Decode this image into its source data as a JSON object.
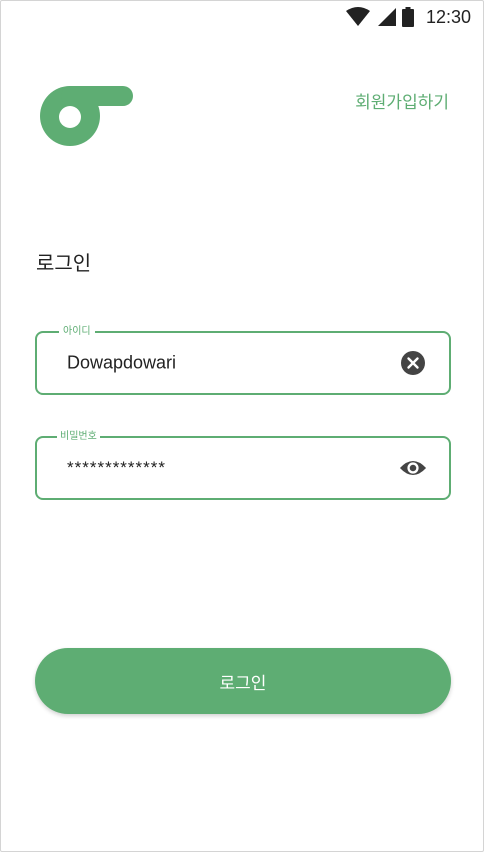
{
  "status_bar": {
    "time": "12:30",
    "icons": [
      "wifi-icon",
      "cell-signal-icon",
      "battery-icon"
    ]
  },
  "header": {
    "logo_icon": "brand-logo-icon",
    "signup_label": "회원가입하기"
  },
  "page_title": "로그인",
  "form": {
    "id_field": {
      "label": "아이디",
      "value": "Dowapdowari",
      "action_icon": "clear-icon"
    },
    "password_field": {
      "label": "비밀번호",
      "value": "*************",
      "action_icon": "eye-icon"
    }
  },
  "login_button_label": "로그인",
  "colors": {
    "accent": "#5ead73",
    "text": "#222222",
    "icon": "#444444"
  }
}
